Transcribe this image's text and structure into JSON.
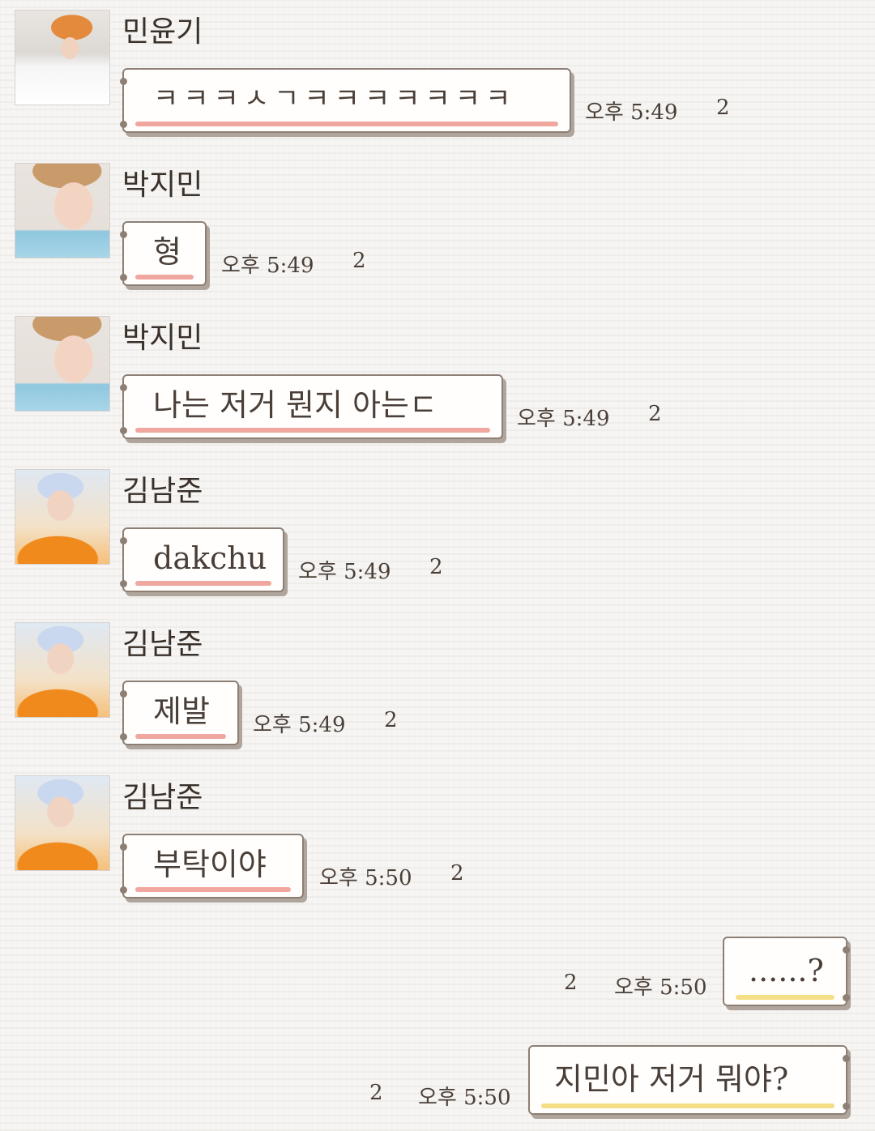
{
  "messages": [
    {
      "sender": "민윤기",
      "avatar": "avatar-yoongi",
      "text": "ㅋㅋㅋㅅㄱㅋㅋㅋㅋㅋㅋㅋ",
      "time": "오후 5:49",
      "unread": "2"
    },
    {
      "sender": "박지민",
      "avatar": "avatar-jimin",
      "text": "형",
      "time": "오후 5:49",
      "unread": "2"
    },
    {
      "sender": "박지민",
      "avatar": "avatar-jimin",
      "text": "나는 저거 뭔지 아는ㄷ",
      "time": "오후 5:49",
      "unread": "2"
    },
    {
      "sender": "김남준",
      "avatar": "avatar-namjoon",
      "text": "dakchu",
      "time": "오후 5:49",
      "unread": "2"
    },
    {
      "sender": "김남준",
      "avatar": "avatar-namjoon",
      "text": "제발",
      "time": "오후 5:49",
      "unread": "2"
    },
    {
      "sender": "김남준",
      "avatar": "avatar-namjoon",
      "text": "부탁이야",
      "time": "오후 5:50",
      "unread": "2"
    }
  ],
  "outgoing": [
    {
      "text": "......?",
      "time": "오후 5:50",
      "unread": "2"
    },
    {
      "text": "지민아 저거 뭐야?",
      "time": "오후 5:50",
      "unread": "2"
    }
  ],
  "colors": {
    "incoming_underline": "#f0a7a0",
    "outgoing_underline": "#f5df86",
    "bubble_border": "#8d7f74"
  }
}
